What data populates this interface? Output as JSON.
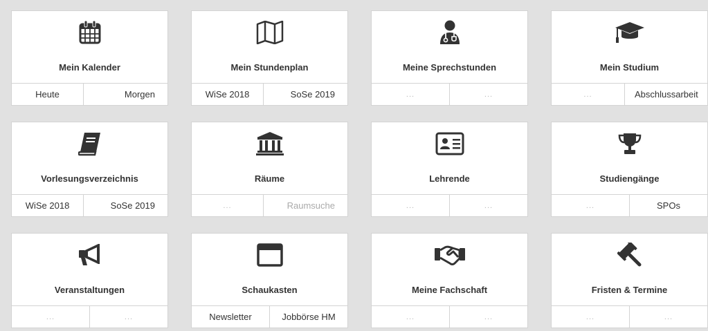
{
  "tiles": [
    {
      "title": "Mein Kalender",
      "icon": "calendar-icon",
      "links": [
        "Heute",
        "Morgen"
      ]
    },
    {
      "title": "Mein Stundenplan",
      "icon": "map-icon",
      "links": [
        "WiSe 2018",
        "SoSe 2019"
      ]
    },
    {
      "title": "Meine Sprechstunden",
      "icon": "doctor-icon",
      "links": [
        "...",
        "..."
      ]
    },
    {
      "title": "Mein Studium",
      "icon": "graduation-cap-icon",
      "links": [
        "...",
        "Abschlussarbeit"
      ]
    },
    {
      "title": "Vorlesungsverzeichnis",
      "icon": "book-icon",
      "links": [
        "WiSe 2018",
        "SoSe 2019"
      ]
    },
    {
      "title": "Räume",
      "icon": "university-building-icon",
      "links": [
        "...",
        "Raumsuche"
      ]
    },
    {
      "title": "Lehrende",
      "icon": "id-card-icon",
      "links": [
        "...",
        "..."
      ]
    },
    {
      "title": "Studiengänge",
      "icon": "trophy-icon",
      "links": [
        "...",
        "SPOs"
      ]
    },
    {
      "title": "Veranstaltungen",
      "icon": "megaphone-icon",
      "links": [
        "...",
        "..."
      ]
    },
    {
      "title": "Schaukasten",
      "icon": "window-icon",
      "links": [
        "Newsletter",
        "Jobbörse HM"
      ]
    },
    {
      "title": "Meine Fachschaft",
      "icon": "handshake-icon",
      "links": [
        "...",
        "..."
      ]
    },
    {
      "title": "Fristen & Termine",
      "icon": "gavel-icon",
      "links": [
        "...",
        "..."
      ]
    }
  ]
}
